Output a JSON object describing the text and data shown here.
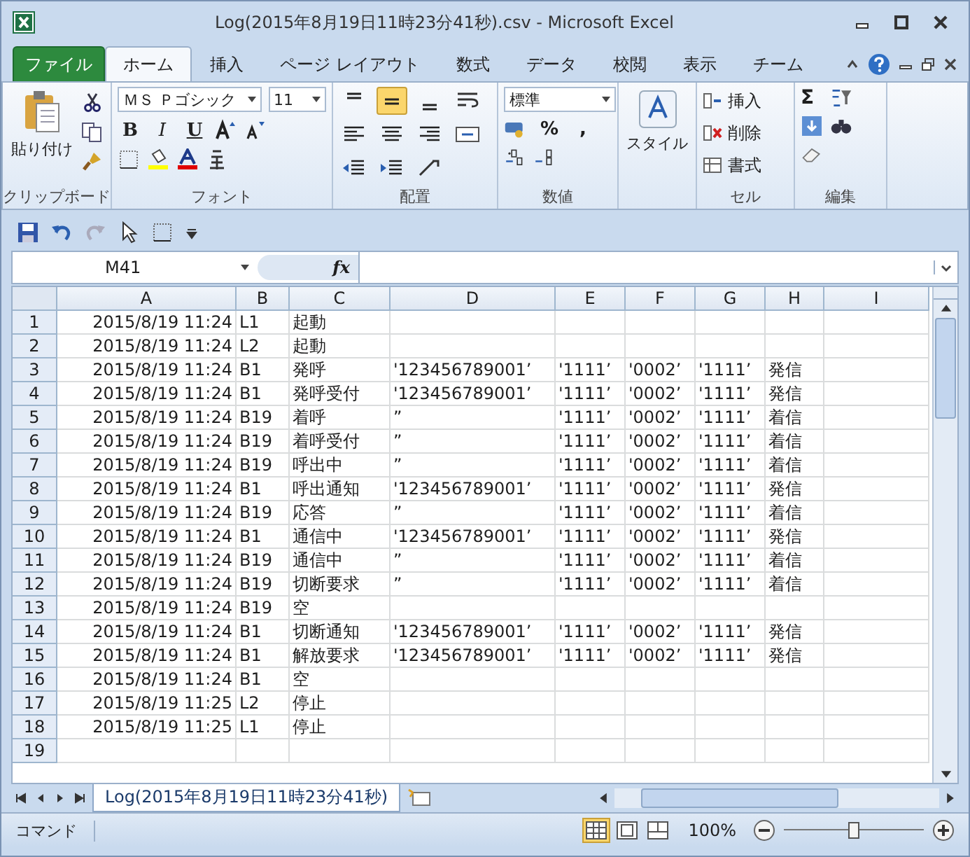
{
  "window": {
    "title": "Log(2015年8月19日11時23分41秒).csv  -  Microsoft Excel"
  },
  "file_tab": "ファイル",
  "tabs": [
    {
      "label": "ホーム",
      "selected": true
    },
    {
      "label": "挿入",
      "selected": false
    },
    {
      "label": "ページ レイアウト",
      "selected": false
    },
    {
      "label": "数式",
      "selected": false
    },
    {
      "label": "データ",
      "selected": false
    },
    {
      "label": "校閲",
      "selected": false
    },
    {
      "label": "表示",
      "selected": false
    },
    {
      "label": "チーム",
      "selected": false
    }
  ],
  "ribbon": {
    "clipboard": {
      "paste": "貼り付け",
      "label": "クリップボード"
    },
    "font": {
      "name": "ＭＳ Ｐゴシック",
      "size": "11",
      "bold": "B",
      "italic": "I",
      "underline": "U",
      "label": "フォント"
    },
    "alignment": {
      "vertical": [
        {
          "selected": false
        },
        {
          "selected": true
        },
        {
          "selected": false
        }
      ],
      "label": "配置"
    },
    "number": {
      "format": "標準",
      "percent": "%",
      "comma": ",",
      "label": "数値"
    },
    "styles": {
      "label": "スタイル"
    },
    "cells": {
      "insert": "挿入",
      "delete": "削除",
      "format": "書式",
      "label": "セル"
    },
    "editing": {
      "sum": "Σ",
      "label": "編集"
    }
  },
  "formula_bar": {
    "name_box": "M41",
    "fx": "fx"
  },
  "columns": [
    {
      "label": "A",
      "kind": "number"
    },
    {
      "label": "B",
      "kind": "text"
    },
    {
      "label": "C",
      "kind": "text"
    },
    {
      "label": "D",
      "kind": "text"
    },
    {
      "label": "E",
      "kind": "text"
    },
    {
      "label": "F",
      "kind": "text"
    },
    {
      "label": "G",
      "kind": "text"
    },
    {
      "label": "H",
      "kind": "text"
    },
    {
      "label": "I",
      "kind": "text"
    }
  ],
  "rows": [
    {
      "number": "1",
      "A": "2015/8/19 11:24",
      "B": "L1",
      "C": "起動"
    },
    {
      "number": "2",
      "A": "2015/8/19 11:24",
      "B": "L2",
      "C": "起動"
    },
    {
      "number": "3",
      "A": "2015/8/19 11:24",
      "B": "B1",
      "C": "発呼",
      "D": "'123456789001’",
      "E": "'1111’",
      "F": "'0002’",
      "G": "'1111’",
      "H": "発信"
    },
    {
      "number": "4",
      "A": "2015/8/19 11:24",
      "B": "B1",
      "C": "発呼受付",
      "D": "'123456789001’",
      "E": "'1111’",
      "F": "'0002’",
      "G": "'1111’",
      "H": "発信"
    },
    {
      "number": "5",
      "A": "2015/8/19 11:24",
      "B": "B19",
      "C": "着呼",
      "D": "”",
      "E": "'1111’",
      "F": "'0002’",
      "G": "'1111’",
      "H": "着信"
    },
    {
      "number": "6",
      "A": "2015/8/19 11:24",
      "B": "B19",
      "C": "着呼受付",
      "D": "”",
      "E": "'1111’",
      "F": "'0002’",
      "G": "'1111’",
      "H": "着信"
    },
    {
      "number": "7",
      "A": "2015/8/19 11:24",
      "B": "B19",
      "C": "呼出中",
      "D": "”",
      "E": "'1111’",
      "F": "'0002’",
      "G": "'1111’",
      "H": "着信"
    },
    {
      "number": "8",
      "A": "2015/8/19 11:24",
      "B": "B1",
      "C": "呼出通知",
      "D": "'123456789001’",
      "E": "'1111’",
      "F": "'0002’",
      "G": "'1111’",
      "H": "発信"
    },
    {
      "number": "9",
      "A": "2015/8/19 11:24",
      "B": "B19",
      "C": "応答",
      "D": "”",
      "E": "'1111’",
      "F": "'0002’",
      "G": "'1111’",
      "H": "着信"
    },
    {
      "number": "10",
      "A": "2015/8/19 11:24",
      "B": "B1",
      "C": "通信中",
      "D": "'123456789001’",
      "E": "'1111’",
      "F": "'0002’",
      "G": "'1111’",
      "H": "発信"
    },
    {
      "number": "11",
      "A": "2015/8/19 11:24",
      "B": "B19",
      "C": "通信中",
      "D": "”",
      "E": "'1111’",
      "F": "'0002’",
      "G": "'1111’",
      "H": "着信"
    },
    {
      "number": "12",
      "A": "2015/8/19 11:24",
      "B": "B19",
      "C": "切断要求",
      "D": "”",
      "E": "'1111’",
      "F": "'0002’",
      "G": "'1111’",
      "H": "着信"
    },
    {
      "number": "13",
      "A": "2015/8/19 11:24",
      "B": "B19",
      "C": "空"
    },
    {
      "number": "14",
      "A": "2015/8/19 11:24",
      "B": "B1",
      "C": "切断通知",
      "D": "'123456789001’",
      "E": "'1111’",
      "F": "'0002’",
      "G": "'1111’",
      "H": "発信"
    },
    {
      "number": "15",
      "A": "2015/8/19 11:24",
      "B": "B1",
      "C": "解放要求",
      "D": "'123456789001’",
      "E": "'1111’",
      "F": "'0002’",
      "G": "'1111’",
      "H": "発信"
    },
    {
      "number": "16",
      "A": "2015/8/19 11:24",
      "B": "B1",
      "C": "空"
    },
    {
      "number": "17",
      "A": "2015/8/19 11:25",
      "B": "L2",
      "C": "停止"
    },
    {
      "number": "18",
      "A": "2015/8/19 11:25",
      "B": "L1",
      "C": "停止"
    },
    {
      "number": "19"
    }
  ],
  "sheet_tabs": [
    {
      "label": "Log(2015年8月19日11時23分41秒)",
      "selected": true
    }
  ],
  "status_bar": {
    "mode": "コマンド",
    "views": [
      {
        "selected": true
      },
      {
        "selected": false
      },
      {
        "selected": false
      }
    ],
    "zoom": "100%",
    "zoom_slider": {
      "level": 0.5
    }
  }
}
